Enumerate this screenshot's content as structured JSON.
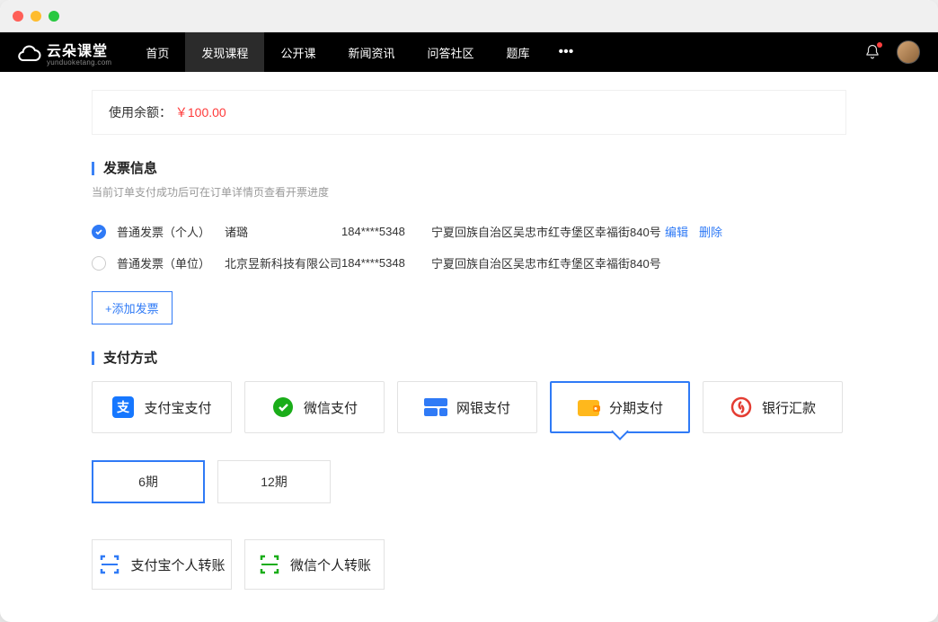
{
  "brand": {
    "name": "云朵课堂",
    "sub": "yunduoketang.com"
  },
  "nav": {
    "items": [
      {
        "label": "首页"
      },
      {
        "label": "发现课程"
      },
      {
        "label": "公开课"
      },
      {
        "label": "新闻资讯"
      },
      {
        "label": "问答社区"
      },
      {
        "label": "题库"
      }
    ]
  },
  "balance": {
    "label": "使用余额：",
    "amount": "￥100.00"
  },
  "invoice": {
    "title": "发票信息",
    "sub": "当前订单支付成功后可在订单详情页查看开票进度",
    "rows": [
      {
        "type": "普通发票（个人）",
        "name": "诸璐",
        "phone": "184****5348",
        "address": "宁夏回族自治区吴忠市红寺堡区幸福街840号",
        "selected": true
      },
      {
        "type": "普通发票（单位）",
        "name": "北京昱新科技有限公司",
        "phone": "184****5348",
        "address": "宁夏回族自治区吴忠市红寺堡区幸福街840号",
        "selected": false
      }
    ],
    "actions": {
      "edit": "编辑",
      "delete": "删除"
    },
    "add": "+添加发票"
  },
  "payment": {
    "title": "支付方式",
    "options": [
      {
        "label": "支付宝支付",
        "icon": "alipay"
      },
      {
        "label": "微信支付",
        "icon": "wechat"
      },
      {
        "label": "网银支付",
        "icon": "unionpay"
      },
      {
        "label": "分期支付",
        "icon": "wallet",
        "selected": true
      },
      {
        "label": "银行汇款",
        "icon": "bank"
      }
    ],
    "periods": [
      {
        "label": "6期",
        "selected": true
      },
      {
        "label": "12期"
      }
    ],
    "transfers": [
      {
        "label": "支付宝个人转账",
        "icon": "scan-blue"
      },
      {
        "label": "微信个人转账",
        "icon": "scan-green"
      }
    ]
  }
}
